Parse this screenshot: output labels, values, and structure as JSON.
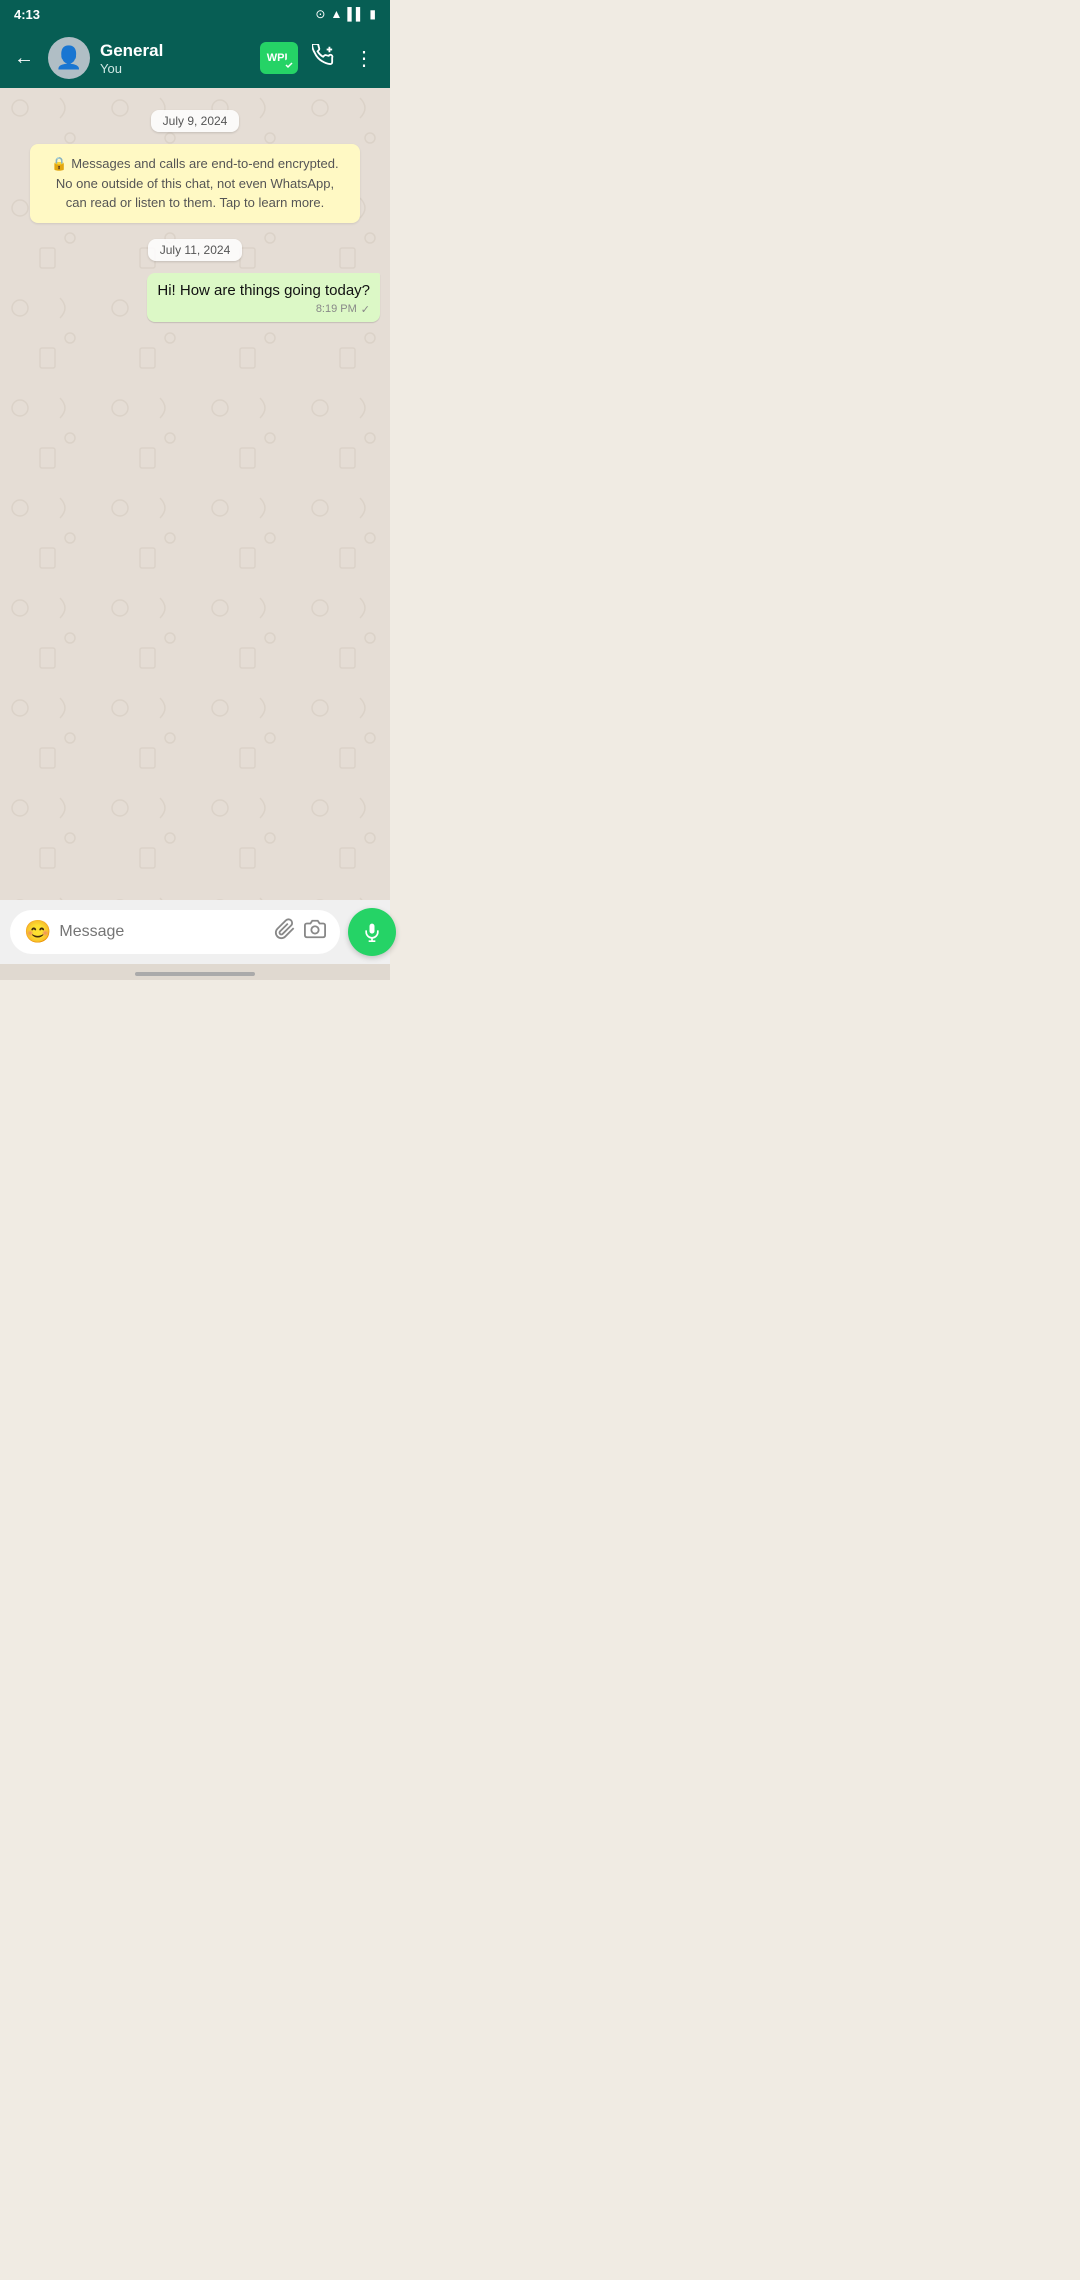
{
  "statusBar": {
    "time": "4:13",
    "cameraIcon": "📷"
  },
  "header": {
    "backLabel": "←",
    "contactName": "General",
    "contactStatus": "You",
    "wplLabel": "WPL",
    "addContactIcon": "+📞",
    "moreIcon": "⋮"
  },
  "chat": {
    "dates": [
      {
        "label": "July 9, 2024",
        "id": "date1"
      },
      {
        "label": "July 11, 2024",
        "id": "date2"
      }
    ],
    "encryptionNotice": "🔒 Messages and calls are end-to-end encrypted. No one outside of this chat, not even WhatsApp, can read or listen to them. Tap to learn more.",
    "messages": [
      {
        "id": "msg1",
        "type": "outgoing",
        "text": "Hi! How are things going today?",
        "time": "8:19 PM",
        "delivered": true
      }
    ]
  },
  "inputBar": {
    "placeholder": "Message",
    "emojiIcon": "😊",
    "attachIcon": "📎",
    "cameraIcon": "📷",
    "micIcon": "🎤"
  }
}
